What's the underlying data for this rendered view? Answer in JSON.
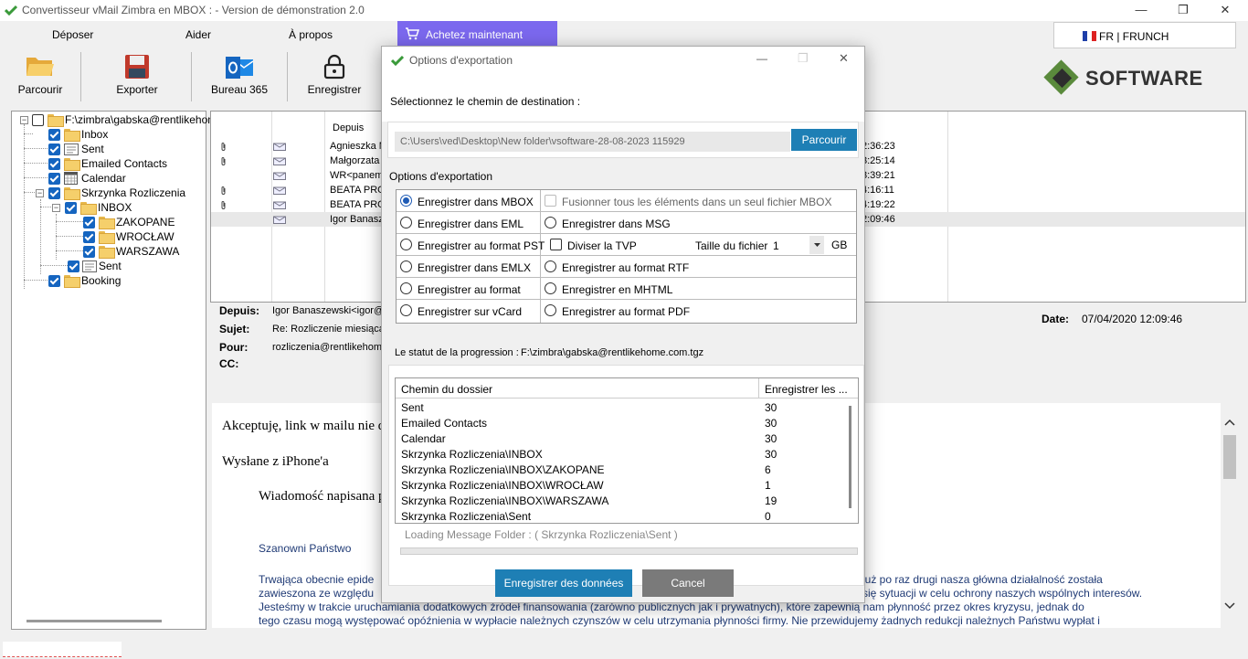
{
  "window": {
    "title": "Convertisseur vMail Zimbra en MBOX : - Version de démonstration 2.0",
    "minimize": "—",
    "maximize": "❐",
    "close": "✕"
  },
  "menu": {
    "items": [
      "Déposer",
      "Aider",
      "À propos"
    ],
    "buy_label": "Achetez maintenant",
    "language": "FR | FRUNCH"
  },
  "toolbar": {
    "buttons": [
      "Parcourir",
      "Exporter",
      "Bureau 365",
      "Enregistrer"
    ]
  },
  "brand": {
    "name": "SOFTWARE",
    "colors": {
      "diamond": "#5a8a3c",
      "text": "#333333"
    }
  },
  "tree": {
    "root": "F:\\zimbra\\gabska@rentlikehome",
    "items": [
      "Inbox",
      "Sent",
      "Emailed Contacts",
      "Calendar",
      "Skrzynka Rozliczenia",
      "INBOX",
      "ZAKOPANE",
      "WROCŁAW",
      "WARSZAWA",
      "Sent",
      "Booking"
    ]
  },
  "maillist": {
    "col_from": "Depuis",
    "rows": [
      {
        "from": "Agnieszka M",
        "time": "2:36:23",
        "attach": true
      },
      {
        "from": "Małgorzata",
        "time": "3:25:14",
        "attach": true
      },
      {
        "from": "WR<panem",
        "time": "3:39:21",
        "attach": false
      },
      {
        "from": "BEATA PRO",
        "time": "4:16:11",
        "attach": true
      },
      {
        "from": "BEATA PRO",
        "time": "4:19:22",
        "attach": true
      },
      {
        "from": "Igor Banasz",
        "time": "2:09:46",
        "attach": false
      }
    ]
  },
  "preview": {
    "from_label": "Depuis:",
    "from_value": "Igor Banaszewski<igor@",
    "subject_label": "Sujet:",
    "subject_value": "Re: Rozliczenie miesiąca",
    "to_label": "Pour:",
    "to_value": "rozliczenia@rentlikehome",
    "cc_label": "CC:",
    "date_label": "Date:",
    "date_value": "07/04/2020 12:09:46"
  },
  "body": {
    "line1": "Akceptuję, link w mailu nie d",
    "line2": "Wysłane z iPhone'a",
    "line3": "Wiadomość napisana p",
    "line4": "Szanowni Państwo",
    "para_a": "Trwająca obecnie epide",
    "para_a_right": "już po raz drugi nasza główna działalność została",
    "para_b": "zawieszona ze względu",
    "para_b_right": "się sytuacji w celu ochrony naszych wspólnych interesów.",
    "para_c": "Jesteśmy w trakcie uruchamiania dodatkowych źródeł finansowania (zarówno publicznych jak i prywatnych), które zapewnią nam płynność przez okres kryzysu, jednak do",
    "para_d": "tego czasu mogą występować opóźnienia w wypłacie należnych czynszów w celu utrzymania płynności firmy. Nie przewidujemy żadnych redukcji należnych Państwu wypłat i"
  },
  "dialog": {
    "title": "Options d'exportation",
    "dest_label": "Sélectionnez le chemin de destination :",
    "dest_path": "C:\\Users\\ved\\Desktop\\New folder\\vsoftware-28-08-2023 115929",
    "browse": "Parcourir",
    "options_label": "Options d'exportation",
    "options_left": [
      "Enregistrer dans MBOX",
      "Enregistrer dans EML",
      "Enregistrer au format PST",
      "Enregistrer dans EMLX",
      "Enregistrer au format",
      "Enregistrer sur vCard"
    ],
    "options_right": [
      "Fusionner tous les éléments dans un seul fichier MBOX",
      "Enregistrer dans MSG",
      "Diviser la TVP",
      "Enregistrer au format RTF",
      "Enregistrer en MHTML",
      "Enregistrer au format PDF"
    ],
    "size_label": "Taille du fichier",
    "size_value": "1",
    "size_unit": "GB",
    "progress_label": "Le statut de la progression :",
    "progress_path": "F:\\zimbra\\gabska@rentlikehome.com.tgz",
    "table_headers": [
      "Chemin du dossier",
      "Enregistrer les ..."
    ],
    "table_rows": [
      [
        "Sent",
        "30"
      ],
      [
        "Emailed Contacts",
        "30"
      ],
      [
        "Calendar",
        "30"
      ],
      [
        "Skrzynka Rozliczenia\\INBOX",
        "30"
      ],
      [
        "Skrzynka Rozliczenia\\INBOX\\ZAKOPANE",
        "6"
      ],
      [
        "Skrzynka Rozliczenia\\INBOX\\WROCŁAW",
        "1"
      ],
      [
        "Skrzynka Rozliczenia\\INBOX\\WARSZAWA",
        "19"
      ],
      [
        "Skrzynka Rozliczenia\\Sent",
        "0"
      ]
    ],
    "loading": "Loading Message Folder : ( Skrzynka Rozliczenia\\Sent )",
    "progress": 0,
    "save_btn": "Enregistrer des données",
    "cancel_btn": "Cancel",
    "colors": {
      "primary": "#1e7fb5",
      "secondary": "#7a7a7a",
      "accent": "#7b68ee"
    }
  }
}
